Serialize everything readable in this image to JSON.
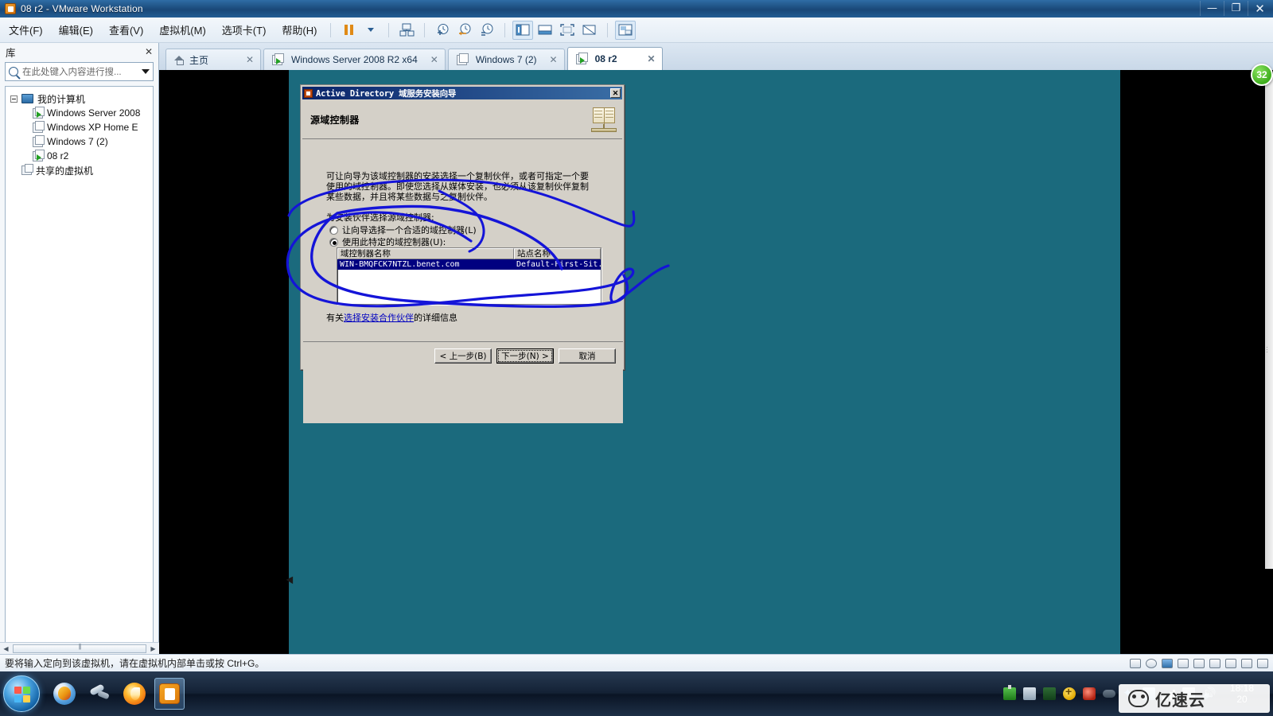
{
  "window": {
    "title": "08 r2 - VMware Workstation",
    "app_icon": "vmware-icon",
    "controls": {
      "minimize": "—",
      "restore": "❐",
      "close": "✕"
    }
  },
  "menubar": {
    "items": [
      {
        "label": "文件(F)",
        "name": "menu-file"
      },
      {
        "label": "编辑(E)",
        "name": "menu-edit"
      },
      {
        "label": "查看(V)",
        "name": "menu-view"
      },
      {
        "label": "虚拟机(M)",
        "name": "menu-vm"
      },
      {
        "label": "选项卡(T)",
        "name": "menu-tabs"
      },
      {
        "label": "帮助(H)",
        "name": "menu-help"
      }
    ],
    "toolbar": [
      {
        "name": "pause-button",
        "icon": "pause-icon"
      },
      {
        "name": "power-dropdown",
        "icon": "chevron-down-icon"
      },
      {
        "name": "manage-snapshots-button",
        "icon": "snapshot-manager-icon"
      },
      {
        "name": "take-snapshot-button",
        "icon": "snapshot-add-icon"
      },
      {
        "name": "revert-snapshot-button",
        "icon": "snapshot-revert-icon"
      },
      {
        "name": "snapshot-manager-button",
        "icon": "snapshot-clock-icon"
      },
      {
        "name": "show-library-button",
        "icon": "library-pane-icon"
      },
      {
        "name": "show-thumbnails-button",
        "icon": "thumbnail-bar-icon"
      },
      {
        "name": "fullscreen-button",
        "icon": "fullscreen-icon"
      },
      {
        "name": "unity-button",
        "icon": "unity-icon"
      },
      {
        "name": "console-view-button",
        "icon": "console-view-icon"
      }
    ]
  },
  "sidebar": {
    "title": "库",
    "close_label": "✕",
    "search": {
      "placeholder": "在此处键入内容进行搜...",
      "value": ""
    },
    "tree": [
      {
        "label": "我的计算机",
        "level": 0,
        "icon": "my-computer-icon",
        "expander": true
      },
      {
        "label": "Windows Server 2008",
        "level": 1,
        "icon": "vm-running-icon"
      },
      {
        "label": "Windows XP Home E",
        "level": 1,
        "icon": "vm-icon"
      },
      {
        "label": "Windows 7 (2)",
        "level": 1,
        "icon": "vm-icon"
      },
      {
        "label": "08 r2",
        "level": 1,
        "icon": "vm-running-icon"
      },
      {
        "label": "共享的虚拟机",
        "level": 0,
        "icon": "shared-vms-icon"
      }
    ]
  },
  "tabs": [
    {
      "label": "主页",
      "icon": "home-icon",
      "active": false,
      "close": "✕"
    },
    {
      "label": "Windows Server 2008 R2 x64",
      "icon": "vm-running-icon",
      "active": false,
      "close": "✕"
    },
    {
      "label": "Windows 7 (2)",
      "icon": "vm-icon",
      "active": false,
      "close": "✕"
    },
    {
      "label": "08 r2",
      "icon": "vm-running-icon",
      "active": true,
      "close": "✕"
    }
  ],
  "vm_screen": {
    "badge": "32",
    "desktop_color": "#1b6a7d"
  },
  "dialog": {
    "title": "Active Directory 域服务安装向导",
    "close_label": "✕",
    "heading": "源域控制器",
    "icon": "book-icon",
    "paragraph": "可让向导为该域控制器的安装选择一个复制伙伴，或者可指定一个要使用的域控制器。即使您选择从媒体安装，也必须从该复制伙伴复制某些数据，并且将某些数据与之复制伙伴。",
    "subheading": "为安装伙伴选择源域控制器:",
    "options": [
      {
        "label": "让向导选择一个合适的域控制器(L)",
        "selected": false
      },
      {
        "label": "使用此特定的域控制器(U):",
        "selected": true
      }
    ],
    "list": {
      "columns": [
        "域控制器名称",
        "站点名称"
      ],
      "rows": [
        {
          "name": "WIN-BMQFCK7NTZL.benet.com",
          "site": "Default-First-Sit...",
          "selected": true
        }
      ]
    },
    "help_prefix": "有关",
    "help_link": "选择安装合作伙伴",
    "help_suffix": "的详细信息",
    "buttons": [
      {
        "label": "< 上一步(B)",
        "name": "back-button",
        "focused": false
      },
      {
        "label": "下一步(N) >",
        "name": "next-button",
        "focused": true
      },
      {
        "label": "取消",
        "name": "cancel-button",
        "focused": false
      }
    ]
  },
  "statusbar": {
    "message": "要将输入定向到该虚拟机，请在虚拟机内部单击或按 Ctrl+G。",
    "devices": [
      "hdd-icon",
      "cdrom-icon",
      "network-icon",
      "printer-icon",
      "sound-icon",
      "usb-icon",
      "floppy-icon",
      "camera-icon",
      "display-icon"
    ]
  },
  "guest_taskbar": {
    "start": "start-orb",
    "apps": [
      {
        "name": "taskbar-qq",
        "icon": "qq-icon",
        "selected": false
      },
      {
        "name": "taskbar-tools",
        "icon": "tools-icon",
        "selected": false
      },
      {
        "name": "taskbar-browser",
        "icon": "fire-browser-icon",
        "selected": false
      },
      {
        "name": "taskbar-vmware",
        "icon": "vmware-icon",
        "selected": true
      }
    ],
    "tray": [
      "usb-icon",
      "network-share-icon",
      "terminal-icon",
      "update-icon",
      "security-icon",
      "cable-icon",
      "bluetooth-icon",
      "monitor-icon",
      "signal-icon",
      "battery-icon",
      "volume-icon"
    ],
    "clock_time": "18:18",
    "clock_date": "20"
  },
  "watermark": {
    "text": "亿速云",
    "logo": "panda-logo-icon"
  }
}
